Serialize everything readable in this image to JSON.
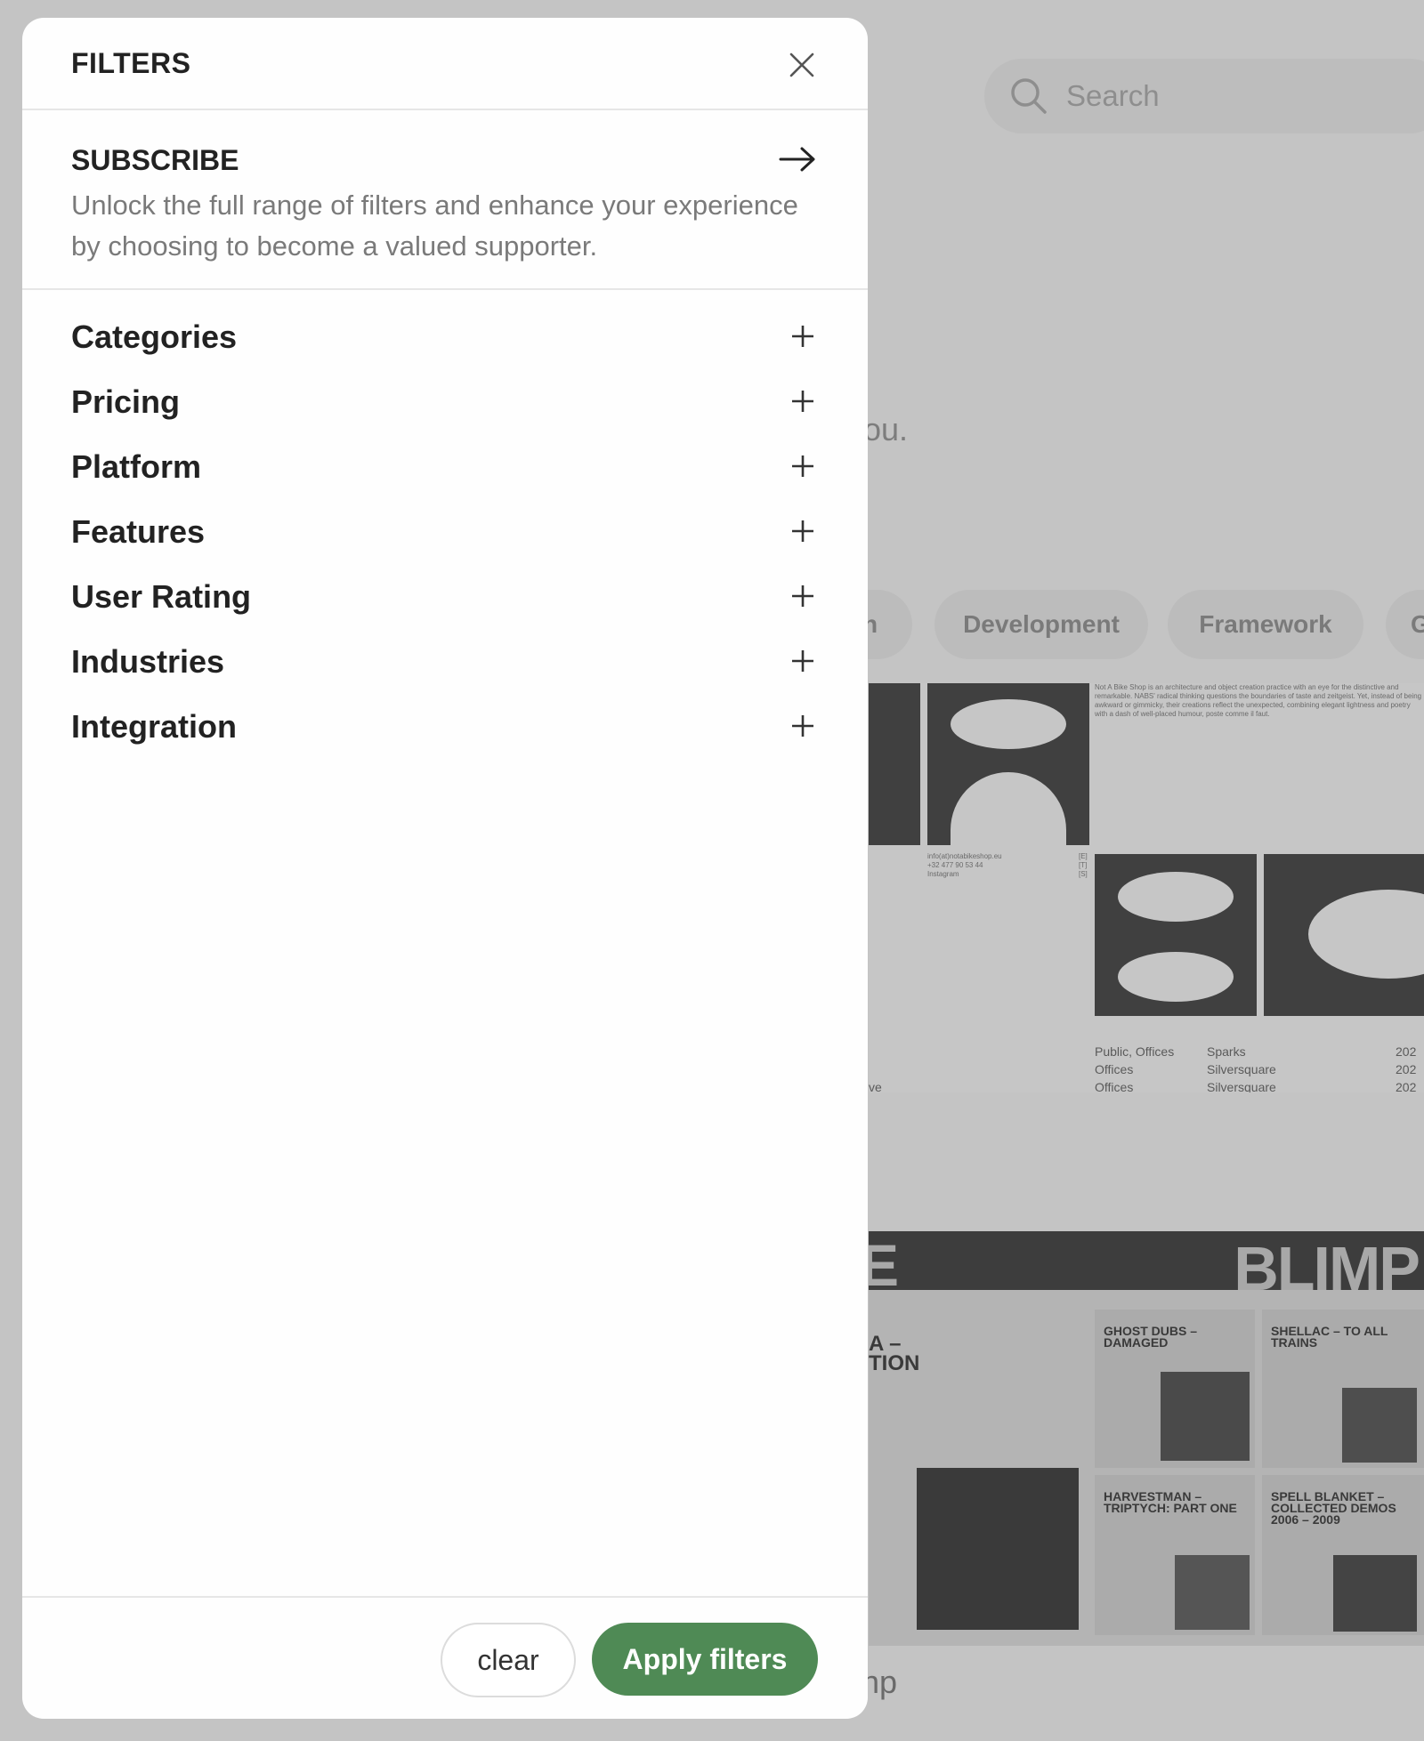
{
  "background": {
    "search_placeholder": "Search",
    "partial_text": "ou.",
    "category_pills": [
      "n",
      "Development",
      "Framework",
      "G"
    ],
    "card1_blurb": "Not A Bike Shop is an architecture and object creation practice with an eye for the distinctive and remarkable. NABS' radical thinking questions the boundaries of taste and zeitgeist. Yet, instead of being awkward or gimmicky, their creations reflect the unexpected, combining elegant lightness and poetry with a dash of well-placed humour, poste comme il faut.",
    "card1_contact": [
      "info(at)notabikeshop.eu",
      "+32 477 90 53 44",
      "Instagram"
    ],
    "card1_contact_tags": [
      "[E]",
      "[T]",
      "[S]"
    ],
    "card1_table": {
      "col1": [
        "Public, Offices",
        "Offices",
        "Offices"
      ],
      "col2": [
        "Sparks",
        "Silversquare",
        "Silversquare"
      ],
      "col3": [
        "202",
        "202",
        "202"
      ]
    },
    "card1_side": "ve",
    "card2_brand": "BLIMP",
    "card2_left_letter": "E",
    "card2_partial_title": "A –\nTION",
    "card2_titles": [
      "GHOST DUBS – DAMAGED",
      "SHELLAC – TO ALL TRAINS",
      "HARVESTMAN – TRIPTYCH: PART ONE",
      "SPELL BLANKET – COLLECTED DEMOS 2006 – 2009"
    ],
    "bottom_partial": "np"
  },
  "panel": {
    "title": "FILTERS",
    "subscribe": {
      "title": "SUBSCRIBE",
      "description": "Unlock the full range of filters and enhance your experience by choosing to become a valued supporter."
    },
    "filters": [
      {
        "label": "Categories"
      },
      {
        "label": "Pricing"
      },
      {
        "label": "Platform"
      },
      {
        "label": "Features"
      },
      {
        "label": "User Rating"
      },
      {
        "label": "Industries"
      },
      {
        "label": "Integration"
      }
    ],
    "footer": {
      "clear_label": "clear",
      "apply_label": "Apply filters"
    }
  },
  "colors": {
    "accent": "#4f8a55",
    "overlay": "#c4c4c4",
    "text_primary": "#222222",
    "text_muted": "#7a7a7a"
  }
}
